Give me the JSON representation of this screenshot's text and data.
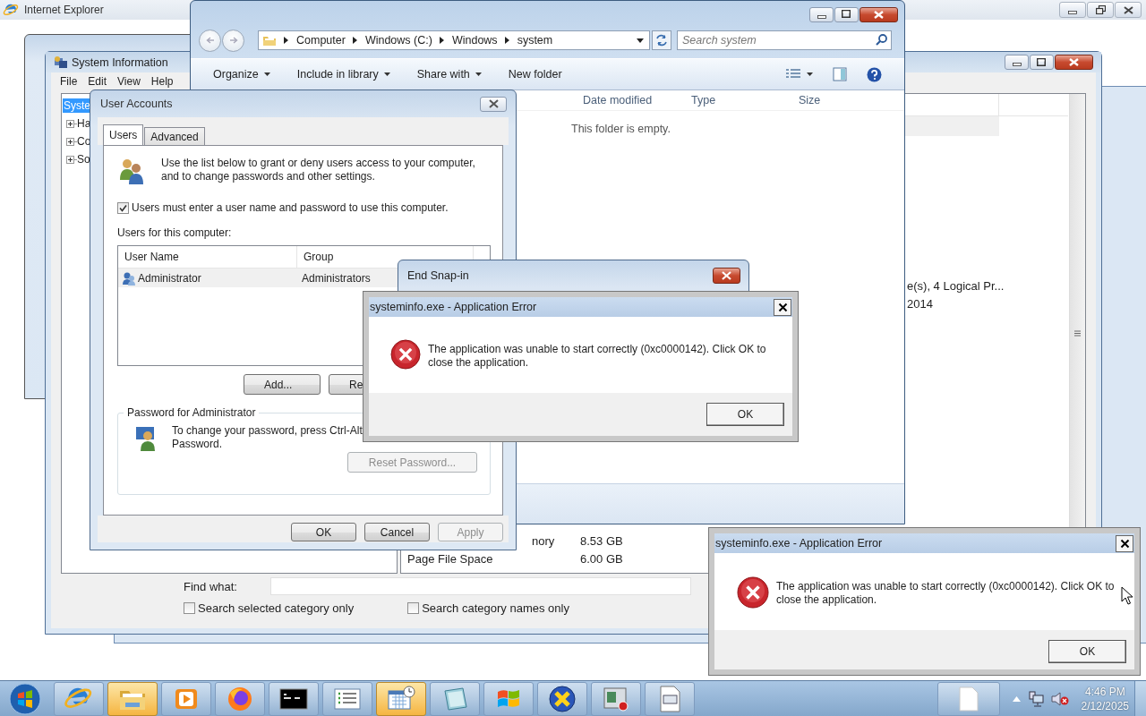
{
  "browser_window": {
    "title": "Internet Explorer"
  },
  "system_information": {
    "title": "System Information",
    "menu": [
      "File",
      "Edit",
      "View",
      "Help"
    ],
    "tree": [
      {
        "label": "Syste",
        "selected": true,
        "children": [
          {
            "label": "Ha",
            "expanded": false
          },
          {
            "label": "Co",
            "expanded": false
          },
          {
            "label": "So",
            "expanded": false
          }
        ]
      }
    ],
    "summary_rows": [
      {
        "kind": "value_tail",
        "value": "e(s), 4 Logical Pr..."
      },
      {
        "kind": "value_tail",
        "value": "2014"
      },
      {
        "kind": "item_tail",
        "item": "nory",
        "value": "8.53 GB"
      },
      {
        "kind": "full",
        "item": "Page File Space",
        "value": "6.00 GB"
      }
    ],
    "find_label": "Find what:",
    "options": [
      {
        "label": "Search selected category only",
        "checked": false
      },
      {
        "label": "Search category names only",
        "checked": false
      }
    ]
  },
  "explorer": {
    "breadcrumbs": [
      "Computer",
      "Windows (C:)",
      "Windows",
      "system"
    ],
    "search": {
      "placeholder": "Search system"
    },
    "toolbar": [
      {
        "label": "Organize",
        "has_menu": true
      },
      {
        "label": "Include in library",
        "has_menu": true
      },
      {
        "label": "Share with",
        "has_menu": true
      },
      {
        "label": "New folder",
        "has_menu": false
      }
    ],
    "columns": [
      "Date modified",
      "Type",
      "Size"
    ],
    "empty_message": "This folder is empty."
  },
  "user_accounts": {
    "title": "User Accounts",
    "tabs": [
      {
        "label": "Users",
        "selected": true
      },
      {
        "label": "Advanced",
        "selected": false
      }
    ],
    "intro": "Use the list below to grant or deny users access to your computer, and to change passwords and other settings.",
    "require_password": {
      "label": "Users must enter a user name and password to use this computer.",
      "checked": true
    },
    "list_label": "Users for this computer:",
    "columns": [
      "User Name",
      "Group"
    ],
    "users": [
      {
        "name": "Administrator",
        "group": "Administrators",
        "selected": true
      }
    ],
    "list_buttons": [
      "Add...",
      "Re"
    ],
    "password_group": {
      "title": "Password for Administrator",
      "lines": [
        "To change your password, press Ctrl-Alt",
        "Password."
      ],
      "button": {
        "label": "Reset Password...",
        "disabled": true
      }
    },
    "buttons": [
      {
        "label": "OK",
        "disabled": false
      },
      {
        "label": "Cancel",
        "disabled": false
      },
      {
        "label": "Apply",
        "disabled": true
      }
    ]
  },
  "snap_in_dialog": {
    "title": "End Snap-in"
  },
  "error_dialogs": [
    {
      "title": "systeminfo.exe - Application Error",
      "message": "The application was unable to start correctly (0xc0000142). Click OK to close the application.",
      "button": "OK"
    },
    {
      "title": "systeminfo.exe - Application Error",
      "message": "The application was unable to start correctly (0xc0000142). Click OK to close the application.",
      "button": "OK"
    }
  ],
  "taskbar": {
    "items": [
      {
        "kind": "browser",
        "active": false
      },
      {
        "kind": "folder",
        "active": true
      },
      {
        "kind": "media",
        "active": false
      },
      {
        "kind": "fox",
        "active": false
      },
      {
        "kind": "terminal",
        "active": false
      },
      {
        "kind": "list",
        "active": false
      },
      {
        "kind": "calendar",
        "active": true
      },
      {
        "kind": "notepad",
        "active": false
      },
      {
        "kind": "flag",
        "active": false
      },
      {
        "kind": "cross",
        "active": false
      },
      {
        "kind": "monitor",
        "active": false
      },
      {
        "kind": "document",
        "active": false
      }
    ],
    "open_window": {
      "kind": "page"
    },
    "tray": [
      {
        "kind": "expand"
      },
      {
        "kind": "network"
      },
      {
        "kind": "muted"
      }
    ],
    "clock": {
      "time": "4:46 PM",
      "date": "2/12/2025"
    }
  }
}
